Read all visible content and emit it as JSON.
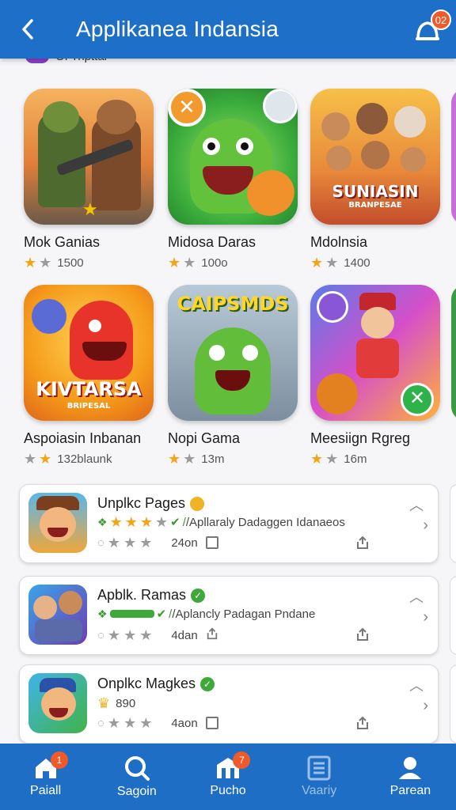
{
  "header": {
    "title": "Applikanea Indansia",
    "notification_count": "02"
  },
  "subheader": {
    "label": "Of Tripttal"
  },
  "grid": {
    "tiles": [
      {
        "name": "Mok Ganias",
        "rating_text": "1500",
        "stars": [
          "on",
          "off"
        ],
        "icon": "soldier-game-art"
      },
      {
        "name": "Midosa Daras",
        "rating_text": "100o",
        "stars": [
          "on",
          "off"
        ],
        "icon": "android-monster-art"
      },
      {
        "name": "Mdolnsia",
        "rating_text": "1400",
        "stars": [
          "on",
          "off"
        ],
        "icon": "group-people-art",
        "art_label": "SUNIASIN",
        "art_sub": "BRANPESAE"
      },
      {
        "name": "Aspoiasin Inbanan",
        "rating_text": "132blaunk",
        "stars": [
          "off",
          "on"
        ],
        "icon": "red-dino-art",
        "art_label": "KIVTARSA",
        "art_sub": "BRIPESAL"
      },
      {
        "name": "Nopi Gama",
        "rating_text": "13m",
        "stars": [
          "on",
          "off"
        ],
        "icon": "android-city-art",
        "art_label": "CAIPSMDS"
      },
      {
        "name": "Meesiign Rgreg",
        "rating_text": "16m",
        "stars": [
          "on",
          "off"
        ],
        "icon": "runner-boy-art"
      }
    ]
  },
  "list": [
    {
      "title": "Unplkc Pages",
      "badge": "gold",
      "row2_text": "/Apllaraly Dadaggen Idanaeos",
      "row2_stars": [
        "on",
        "on",
        "on",
        "off"
      ],
      "row3_stars": [
        "off",
        "off",
        "off"
      ],
      "row3_count": "24on"
    },
    {
      "title": "Apblk. Ramas",
      "badge": "verified",
      "row2_text": "/Aplancly Padagan Pndane",
      "row2_stars": [],
      "row3_stars": [
        "off",
        "off",
        "off"
      ],
      "row3_count": "4dan"
    },
    {
      "title": "Onplkc Magkes",
      "badge": "verified",
      "row2_text": "890",
      "row2_stars": [],
      "row3_stars": [
        "off",
        "off",
        "off"
      ],
      "row3_count": "4aon"
    }
  ],
  "bottom_nav": [
    {
      "label": "Paiall",
      "icon": "home-icon",
      "badge": "1"
    },
    {
      "label": "Sagoin",
      "icon": "search-icon",
      "badge": ""
    },
    {
      "label": "Pucho",
      "icon": "store-icon",
      "badge": "7"
    },
    {
      "label": "Vaariy",
      "icon": "list-icon",
      "badge": ""
    },
    {
      "label": "Parean",
      "icon": "profile-icon",
      "badge": ""
    }
  ],
  "colors": {
    "header": "#1e6fc7",
    "nav": "#1f6ec5",
    "star": "#f2a516",
    "accent_green": "#3a9a2c"
  }
}
